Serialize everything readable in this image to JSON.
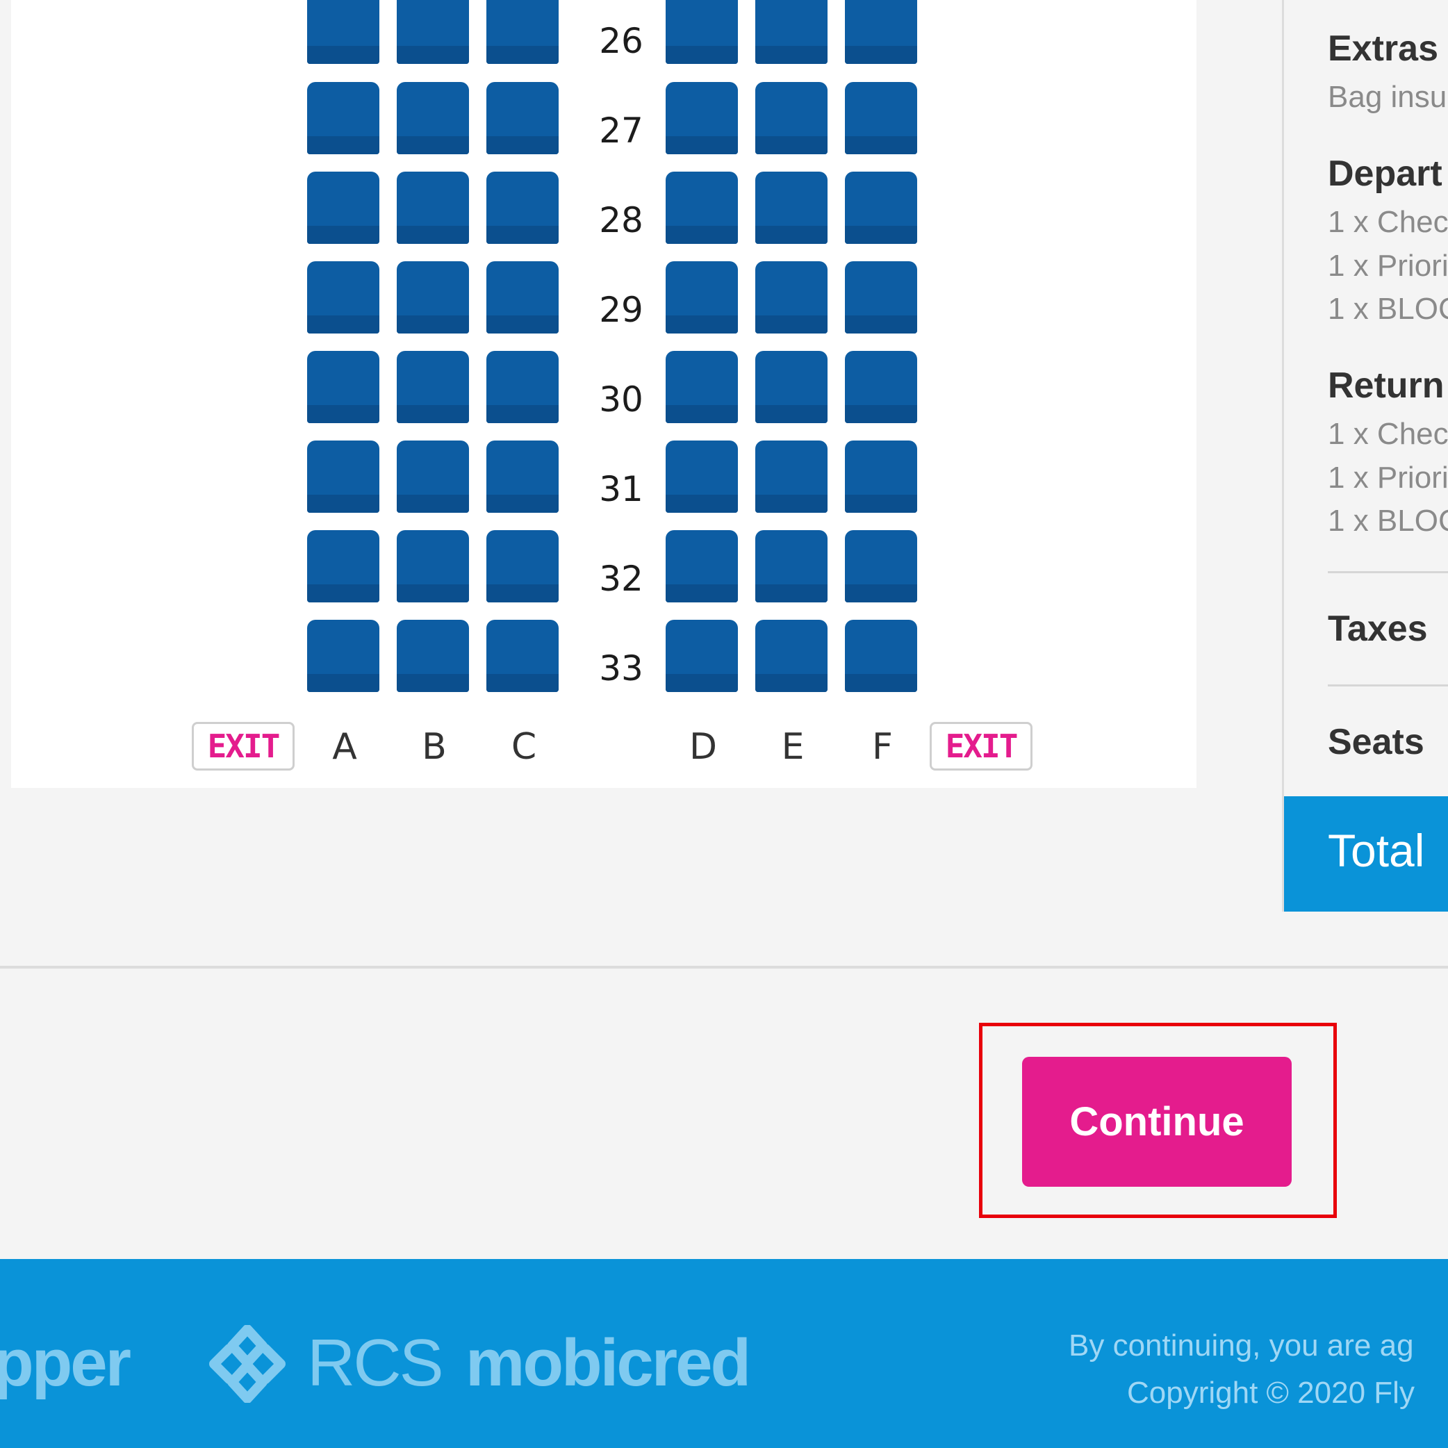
{
  "seat_map": {
    "rows": [
      "26",
      "27",
      "28",
      "29",
      "30",
      "31",
      "32",
      "33"
    ],
    "columns": [
      "A",
      "B",
      "C",
      "D",
      "E",
      "F"
    ],
    "exit_label": "EXIT"
  },
  "summary": {
    "extras_heading": "Extras",
    "extras_sub": "Bag insu",
    "departure_heading": "Depart",
    "departure_items": [
      "1 x Chec",
      "1 x Priori",
      "1 x BLOC"
    ],
    "return_heading": "Return",
    "return_items": [
      "1 x Chec",
      "1 x Priori",
      "1 x BLOC"
    ],
    "taxes_label": "Taxes",
    "seats_label": "Seats",
    "total_label": "Total"
  },
  "actions": {
    "continue_label": "Continue"
  },
  "footer": {
    "brands": [
      "pper",
      "RCS",
      "mobicred"
    ],
    "legal_text": "By continuing, you are ag",
    "copyright": "Copyright © 2020 Fly"
  },
  "colors": {
    "seat": "#0d5da3",
    "accent_pink": "#e41c8d",
    "footer_blue": "#0a93d8",
    "highlight_red": "#e8000b"
  }
}
